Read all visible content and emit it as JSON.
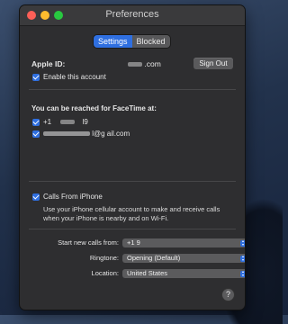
{
  "window": {
    "title": "Preferences"
  },
  "tabs": [
    {
      "label": "Settings",
      "active": true
    },
    {
      "label": "Blocked",
      "active": false
    }
  ],
  "account": {
    "apple_id_label": "Apple ID:",
    "apple_id_value": ".com",
    "sign_out_label": "Sign Out",
    "enable_label": "Enable this account",
    "enable_checked": true
  },
  "reach": {
    "title": "You can be reached for FaceTime at:",
    "addresses": [
      {
        "prefix": "+1",
        "suffix": "l9",
        "checked": true
      },
      {
        "prefix": "",
        "suffix": "l@g  ail.com",
        "checked": true
      }
    ]
  },
  "calls_from_iphone": {
    "label": "Calls From iPhone",
    "checked": true,
    "description": "Use your iPhone cellular account to make and receive calls when your iPhone is nearby and on Wi-Fi."
  },
  "settings": {
    "start_calls_label": "Start new calls from:",
    "start_calls_value": "+1                    9",
    "ringtone_label": "Ringtone:",
    "ringtone_value": "Opening (Default)",
    "location_label": "Location:",
    "location_value": "United States"
  },
  "help_label": "?",
  "colors": {
    "accent": "#2f6fe0",
    "window_bg": "#2e2e30"
  }
}
